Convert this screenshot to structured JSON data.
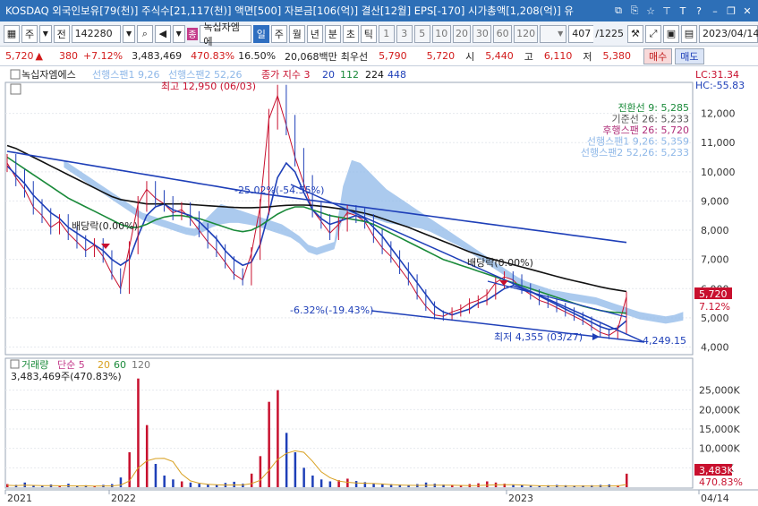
{
  "titlebar": {
    "text": "KOSDAQ 외국인보유[79(천)] 주식수[21,117(천)] 액면[500] 자본금[106(억)] 결산[12월] EPS[-170] 시가총액[1,208(억)] 유"
  },
  "toolbar": {
    "market": "주",
    "prev": "전",
    "code": "142280",
    "stock_badge": "종",
    "stock_name": "녹십자엠에",
    "period_day": "일",
    "period_week": "주",
    "period_month": "월",
    "period_year": "년",
    "period_minute": "분",
    "period_second": "초",
    "period_tick": "틱",
    "intervals": [
      "1",
      "3",
      "5",
      "10",
      "20",
      "30",
      "60",
      "120"
    ],
    "count": "407",
    "total": "/1225",
    "date": "2023/04/14"
  },
  "quote": {
    "price": "5,720",
    "change": "380",
    "change_pct": "+7.12%",
    "volume": "3,483,469",
    "volume_pct": "470.83%",
    "turnover": "16.50%",
    "amount": "20,068백만",
    "best_label": "최우선",
    "best_ask": "5,790",
    "best_bid": "5,720",
    "open_label": "시",
    "open": "5,440",
    "high_label": "고",
    "high": "6,110",
    "low_label": "저",
    "low": "5,380",
    "buy_label": "매수",
    "sell_label": "매도"
  },
  "chart_data": [
    {
      "type": "line",
      "name": "price-panel",
      "legend": {
        "stock": "녹십자엠에스",
        "span1": "선행스팬1 9,26",
        "span2": "선행스팬2 52,26",
        "ma_label": "종가 지수 3",
        "ma20": "20",
        "ma112": "112",
        "ma224": "224",
        "ma448": "448"
      },
      "top_right": {
        "lc": "LC:31.34",
        "hc": "HC:-55.83"
      },
      "ichimoku_legend": [
        {
          "text": "전환선 9: 5,285",
          "color": "#1a8a3a"
        },
        {
          "text": "기준선 26: 5,233",
          "color": "#555555"
        },
        {
          "text": "후행스팬 26: 5,720",
          "color": "#b0307a"
        },
        {
          "text": "선행스팬1 9,26: 5,359",
          "color": "#8fb8e8"
        },
        {
          "text": "선행스팬2 52,26: 5,233",
          "color": "#8fb8e8"
        }
      ],
      "annotations": {
        "high": "최고 12,950 (06/03)",
        "low": "최저 4,355 (03/27)",
        "dividend1": "배당락(0.00%)",
        "dividend2": "배당락(0.00%)",
        "trend_down": "-25.02%(-54.55%)",
        "trend_low": "-6.32%(-19.43%)",
        "trend_end": "4,249.15"
      },
      "ylim": [
        3800,
        13000
      ],
      "y_ticks": [
        "12,000",
        "11,000",
        "10,000",
        "9,000",
        "8,000",
        "7,000",
        "6,000",
        "5,000",
        "4,000"
      ],
      "last_price": "5,720",
      "last_pct": "7.12%",
      "series": [
        {
          "name": "close",
          "color": "#c8102e",
          "values": [
            10300,
            9800,
            9400,
            8800,
            8500,
            8100,
            8300,
            7900,
            7600,
            7300,
            7500,
            7100,
            6500,
            6000,
            7400,
            8900,
            9400,
            9100,
            8900,
            8600,
            8700,
            8400,
            8000,
            7600,
            7300,
            6900,
            6500,
            6300,
            7200,
            8800,
            11800,
            12600,
            11600,
            10500,
            9600,
            8700,
            8300,
            7900,
            8200,
            8600,
            8500,
            8300,
            7800,
            7400,
            7100,
            6700,
            6300,
            5800,
            5400,
            5100,
            5050,
            5200,
            5300,
            5500,
            5600,
            5800,
            6200,
            6400,
            6300,
            6000,
            5800,
            5600,
            5500,
            5350,
            5200,
            5050,
            4900,
            4700,
            4500,
            4400,
            4600,
            5720
          ]
        },
        {
          "name": "ma20",
          "color": "#1e3fb8",
          "values": [
            10200,
            9900,
            9600,
            9200,
            8900,
            8600,
            8400,
            8100,
            7900,
            7700,
            7500,
            7300,
            7000,
            6800,
            7000,
            7800,
            8500,
            8800,
            8900,
            8700,
            8600,
            8500,
            8300,
            8000,
            7700,
            7300,
            7000,
            6800,
            6900,
            7500,
            8600,
            9800,
            10300,
            10000,
            9300,
            8700,
            8400,
            8200,
            8300,
            8400,
            8500,
            8400,
            8100,
            7800,
            7400,
            7000,
            6600,
            6200,
            5800,
            5400,
            5200,
            5100,
            5200,
            5300,
            5500,
            5600,
            5800,
            6000,
            6100,
            6000,
            5900,
            5750,
            5600,
            5450,
            5300,
            5150,
            5000,
            4850,
            4700,
            4600,
            4650,
            4900
          ]
        },
        {
          "name": "ma112",
          "color": "#1a8a3a",
          "values": [
            10500,
            10300,
            10100,
            9900,
            9700,
            9500,
            9300,
            9100,
            8950,
            8800,
            8650,
            8500,
            8350,
            8200,
            8100,
            8100,
            8200,
            8350,
            8450,
            8500,
            8500,
            8450,
            8400,
            8300,
            8200,
            8100,
            8000,
            7950,
            8000,
            8150,
            8350,
            8550,
            8700,
            8800,
            8800,
            8700,
            8600,
            8500,
            8450,
            8400,
            8350,
            8300,
            8200,
            8050,
            7900,
            7750,
            7600,
            7450,
            7300,
            7150,
            7000,
            6900,
            6800,
            6700,
            6600,
            6500,
            6400,
            6300,
            6200,
            6100,
            6000,
            5900,
            5800,
            5700,
            5600,
            5500,
            5400,
            5320,
            5250,
            5200,
            5180,
            5160
          ]
        },
        {
          "name": "ma224",
          "color": "#111111",
          "values": [
            10900,
            10800,
            10650,
            10500,
            10350,
            10200,
            10050,
            9900,
            9750,
            9600,
            9450,
            9300,
            9150,
            9050,
            9000,
            8950,
            8900,
            8900,
            8900,
            8900,
            8900,
            8880,
            8860,
            8840,
            8820,
            8800,
            8780,
            8770,
            8770,
            8780,
            8800,
            8830,
            8850,
            8860,
            8860,
            8850,
            8820,
            8780,
            8740,
            8700,
            8640,
            8580,
            8500,
            8400,
            8300,
            8200,
            8100,
            7980,
            7860,
            7740,
            7620,
            7500,
            7380,
            7260,
            7160,
            7060,
            6980,
            6900,
            6820,
            6740,
            6660,
            6580,
            6500,
            6420,
            6340,
            6270,
            6200,
            6130,
            6060,
            6000,
            5950,
            5900
          ]
        },
        {
          "name": "ma448",
          "color": "#1e3fb8",
          "values": [
            10700,
            10650,
            10600,
            10550,
            10500,
            10450,
            10400,
            10350,
            10300,
            10250,
            10200,
            10150,
            10100,
            10050,
            10000,
            9950,
            9900,
            9850,
            9800,
            9750,
            9700,
            9650,
            9600,
            9550,
            9500,
            9450,
            9400,
            9350,
            9300,
            9260,
            9220,
            9180,
            9140,
            9100,
            9060,
            9020,
            8980,
            8940,
            8900,
            8860,
            8820,
            8780,
            8740,
            8700,
            8660,
            8620,
            8580,
            8540,
            8500,
            8460,
            8420,
            8380,
            8340,
            8300,
            8260,
            8220,
            8180,
            8140,
            8100,
            8060,
            8020,
            7980,
            7940,
            7900,
            7860,
            7820,
            7780,
            7740,
            7700,
            7660,
            7620,
            7580
          ]
        },
        {
          "name": "span-cloud",
          "color": "#8fb8e8",
          "values": [
            10400,
            10200,
            10000,
            9800,
            9600,
            9400,
            9200,
            9000,
            8800,
            8600,
            8500,
            8400,
            8300,
            8200,
            8100,
            8050,
            8300,
            8600,
            8900,
            8800,
            8700,
            8600,
            8500,
            8400,
            8300,
            8200,
            8000,
            7800,
            7500,
            7400,
            7500,
            7600,
            9500,
            10400,
            10300,
            10000,
            9700,
            9400,
            9200,
            9000,
            8800,
            8600,
            8400,
            8200,
            8000,
            7800,
            7600,
            7400,
            7200,
            7000,
            6800,
            6600,
            6400,
            6250,
            6150,
            6050,
            5950,
            5900,
            5850,
            5800,
            5750,
            5700,
            5600,
            5500,
            5400,
            5300,
            5200,
            5150,
            5100,
            5050,
            5100,
            5200
          ]
        }
      ],
      "dates": [
        "2021",
        "2022",
        "2023",
        "04/14"
      ]
    },
    {
      "type": "bar",
      "name": "volume-panel",
      "legend": {
        "title": "거래량",
        "ma_label": "단순 5",
        "ma20": "20",
        "ma60": "60",
        "ma120": "120",
        "current": "3,483,469주(470.83%)"
      },
      "ylim": [
        0,
        30000
      ],
      "y_ticks": [
        "25,000K",
        "20,000K",
        "15,000K",
        "10,000K",
        "5,000K"
      ],
      "last_value": "3,483K",
      "last_pct": "470.83%",
      "values": [
        800,
        600,
        1200,
        500,
        400,
        700,
        300,
        900,
        400,
        500,
        300,
        600,
        800,
        2500,
        9000,
        28000,
        16000,
        6000,
        3000,
        2000,
        1500,
        1200,
        900,
        800,
        700,
        1100,
        1400,
        900,
        3500,
        8000,
        22000,
        25000,
        14000,
        9000,
        5000,
        3000,
        2000,
        1500,
        1800,
        2200,
        1600,
        1300,
        1000,
        900,
        800,
        700,
        600,
        800,
        1200,
        900,
        700,
        600,
        500,
        800,
        1000,
        1500,
        1200,
        900,
        700,
        600,
        500,
        400,
        500,
        600,
        500,
        400,
        450,
        500,
        600,
        700,
        500,
        3483
      ]
    },
    {
      "type": "line",
      "name": "x-axis",
      "x_labels": [
        "2021",
        "2022",
        "2023",
        "04/14"
      ]
    }
  ]
}
